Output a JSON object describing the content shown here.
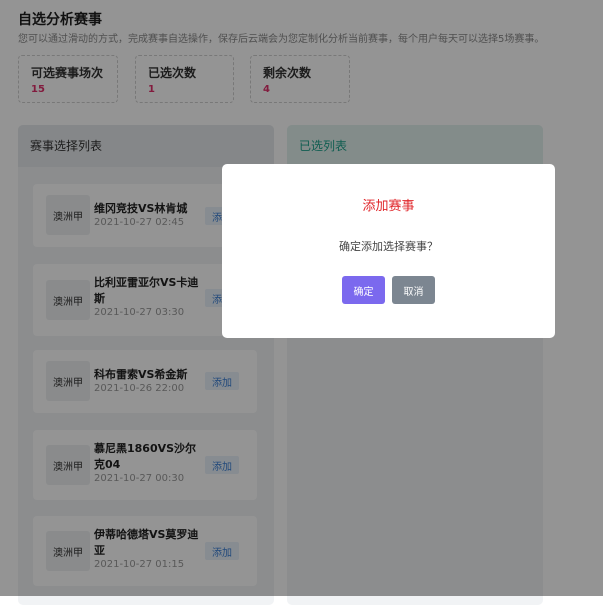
{
  "header": {
    "title": "自选分析赛事",
    "description": "您可以通过滑动的方式，完成赛事自选操作，保存后云端会为您定制化分析当前赛事，每个用户每天可以选择5场赛事。"
  },
  "stats": [
    {
      "label": "可选赛事场次",
      "value": "15"
    },
    {
      "label": "已选次数",
      "value": "1"
    },
    {
      "label": "剩余次数",
      "value": "4"
    }
  ],
  "left_panel": {
    "title": "赛事选择列表",
    "add_label": "添加",
    "matches": [
      {
        "league": "澳洲甲",
        "teams": "维冈竞技VS林肯城",
        "time": "2021-10-27 02:45"
      },
      {
        "league": "澳洲甲",
        "teams": "比利亚雷亚尔VS卡迪斯",
        "time": "2021-10-27 03:30"
      },
      {
        "league": "澳洲甲",
        "teams": "科布雷索VS希金斯",
        "time": "2021-10-26 22:00"
      },
      {
        "league": "澳洲甲",
        "teams": "慕尼黑1860VS沙尔克04",
        "time": "2021-10-27 00:30"
      },
      {
        "league": "澳洲甲",
        "teams": "伊蒂哈德塔VS莫罗迪亚",
        "time": "2021-10-27 01:15"
      }
    ]
  },
  "right_panel": {
    "title": "已选列表"
  },
  "dialog": {
    "title": "添加赛事",
    "message": "确定添加选择赛事？",
    "confirm_label": "确定",
    "cancel_label": "取消"
  }
}
